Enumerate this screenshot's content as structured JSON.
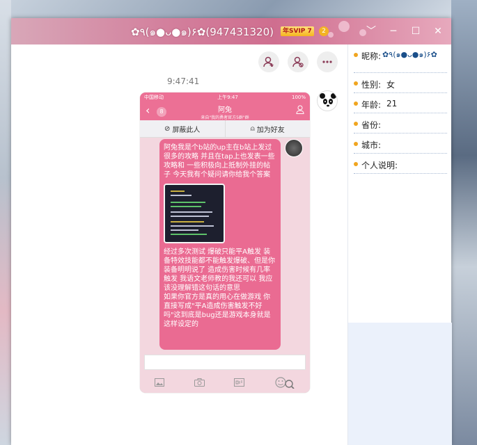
{
  "window": {
    "title": "✿٩(๑●ᴗ●๑)۶✿(947431320)",
    "vip_badge": "年SVIP 7",
    "vip_level": "2",
    "controls": [
      "﹀",
      "─",
      "☐",
      "✕"
    ]
  },
  "chat": {
    "timestamp": "9:47:41",
    "action_icons": [
      "add-friend-icon",
      "add-contact-icon",
      "more-icon"
    ]
  },
  "screenshot": {
    "status_carrier": "中国移动",
    "status_time": "上午9:47",
    "status_battery": "100%",
    "back_count": "8",
    "contact_name": "阿兔",
    "contact_subtitle": "来自\"我的勇者官方5群\"群",
    "action_block": "屏蔽此人",
    "action_add": "加为好友",
    "message_part1": "阿兔我是个b站的up主在b站上发过很多的攻略 并且在tap上也发表一些攻略和 一些积极向上抵制外挂的帖子 今天我有个疑问请你给我个答案",
    "message_part2": "经过多次测试 爆破只能平A触发 装备特效技能都不能触发爆破、但是你装备明明说了 造成伤害时候有几率触发 我语文老师教的我还可以 我应该没理解错这句话的意思",
    "message_part3": "如果你官方是真的用心在做游戏 你直接写成\"平A造成伤害触发不好吗\"这到底是bug还是游戏本身就是这样设定的",
    "toolbar_icons": [
      "image-icon",
      "camera-icon",
      "gif-icon",
      "emoji-icon"
    ]
  },
  "profile": {
    "nickname_label": "昵称:",
    "nickname_value": "✿٩(๑●ᴗ●๑)۶✿",
    "gender_label": "性别:",
    "gender_value": "女",
    "age_label": "年龄:",
    "age_value": "21",
    "province_label": "省份:",
    "province_value": "",
    "city_label": "城市:",
    "city_value": "",
    "bio_label": "个人说明:",
    "bio_value": ""
  }
}
